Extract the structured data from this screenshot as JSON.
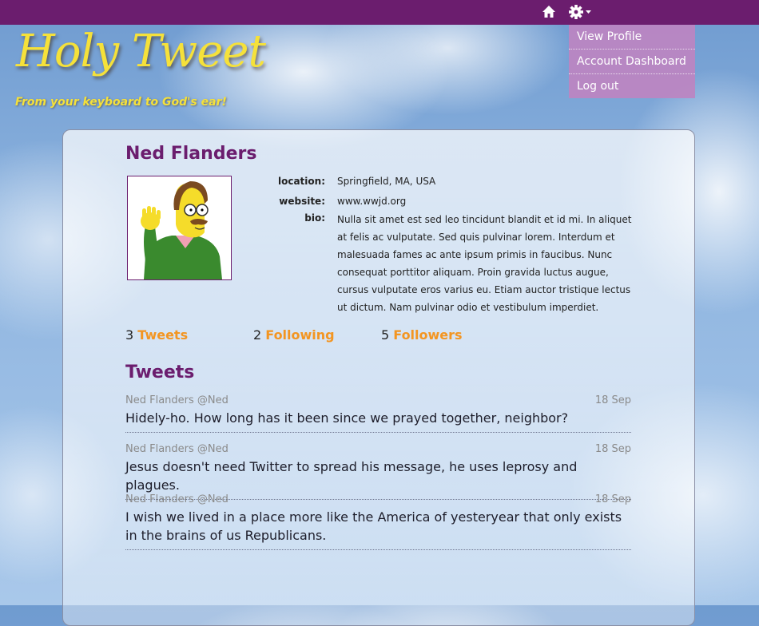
{
  "nav": {
    "icons": [
      "home-icon",
      "gear-icon",
      "caret-down-icon"
    ],
    "menu": [
      {
        "label": "View Profile"
      },
      {
        "label": "Account Dashboard"
      },
      {
        "label": "Log out"
      }
    ]
  },
  "brand": {
    "title": "Holy Tweet",
    "tagline": "From your keyboard to God's ear!",
    "title_color": "#f5e13a",
    "accent_color": "#6b1d6e"
  },
  "profile": {
    "name": "Ned Flanders",
    "location_label": "location:",
    "location": "Springfield, MA, USA",
    "website_label": "website:",
    "website": "www.wwjd.org",
    "bio_label": "bio:",
    "bio": "Nulla sit amet est sed leo tincidunt blandit et id mi. In aliquet at felis ac vulputate. Sed quis pulvinar lorem. Interdum et malesuada fames ac ante ipsum primis in faucibus. Nunc consequat porttitor aliquam. Proin gravida luctus augue, cursus vulputate eros varius eu. Etiam auctor tristique lectus ut dictum. Nam pulvinar odio et vestibulum imperdiet."
  },
  "stats": [
    {
      "count": "3",
      "label": "Tweets"
    },
    {
      "count": "2",
      "label": "Following"
    },
    {
      "count": "5",
      "label": "Followers"
    }
  ],
  "tweets_title": "Tweets",
  "tweets": [
    {
      "author": "Ned Flanders @Ned",
      "date": "18 Sep",
      "text": "Hidely-ho. How long has it been since we prayed together, neighbor?"
    },
    {
      "author": "Ned Flanders @Ned",
      "date": "18 Sep",
      "text": "Jesus doesn't need Twitter to spread his message, he uses leprosy and plagues."
    },
    {
      "author": "Ned Flanders @Ned",
      "date": "18 Sep",
      "text": "I wish we lived in a place more like the America of yesteryear that only exists in the brains of us Republicans."
    }
  ]
}
